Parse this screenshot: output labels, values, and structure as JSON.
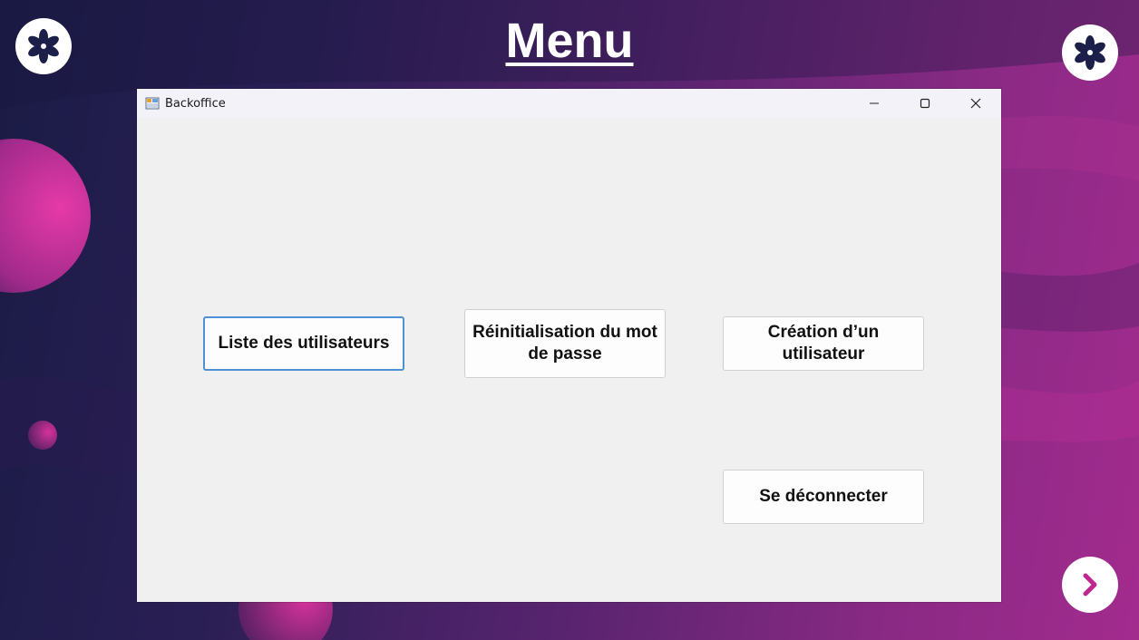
{
  "slide": {
    "title": "Menu"
  },
  "window": {
    "title": "Backoffice",
    "controls": [
      "minimize-icon",
      "maximize-icon",
      "close-icon"
    ]
  },
  "buttons": {
    "users_list": "Liste des utilisateurs",
    "reset_password": "Réinitialisation du mot de passe",
    "create_user": "Création d’un utilisateur",
    "logout": "Se déconnecter"
  },
  "colors": {
    "focus_border": "#4f8fd6",
    "accent_pink": "#c0288f",
    "logo_dark": "#1c1f4a"
  }
}
